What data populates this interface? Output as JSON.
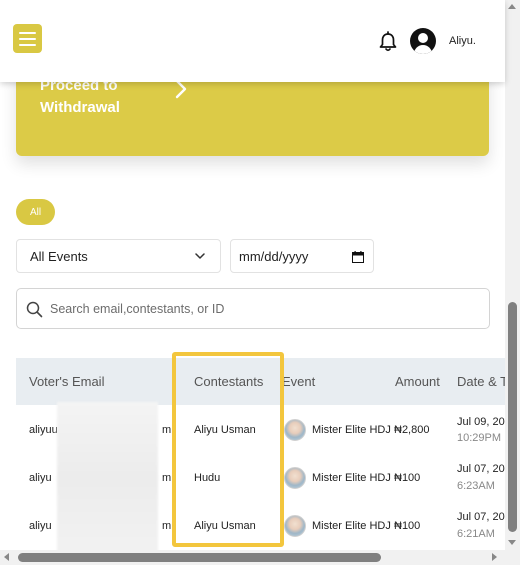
{
  "header": {
    "menu_icon": "hamburger-menu-icon",
    "notification_icon": "bell-icon",
    "avatar_icon": "user-avatar-icon",
    "username": "Aliyu."
  },
  "withdrawal_card": {
    "label_line1": "Proceed to",
    "label_line2": "Withdrawal",
    "chevron_icon": "chevron-right-icon"
  },
  "filters": {
    "chip_label": "All",
    "event_select": "All Events",
    "date_placeholder": "mm/dd/yyyy"
  },
  "search": {
    "placeholder": "Search email,contestants, or ID"
  },
  "table": {
    "headers": {
      "email": "Voter's Email",
      "contestants": "Contestants",
      "event": "Event",
      "amount": "Amount",
      "date": "Date & T"
    },
    "rows": [
      {
        "email_prefix": "aliyuu",
        "email_suffix": "m",
        "contestant": "Aliyu Usman",
        "event": "Mister Elite HDJ",
        "amount": "₦2,800",
        "date": "Jul 09, 20",
        "time": "10:29PM"
      },
      {
        "email_prefix": "aliyu",
        "email_suffix": "m",
        "contestant": "Hudu",
        "event": "Mister Elite HDJ",
        "amount": "₦100",
        "date": "Jul 07, 20",
        "time": "6:23AM"
      },
      {
        "email_prefix": "aliyu",
        "email_suffix": "m",
        "contestant": "Aliyu Usman",
        "event": "Mister Elite HDJ",
        "amount": "₦100",
        "date": "Jul 07, 20",
        "time": "6:21AM"
      }
    ]
  },
  "colors": {
    "accent": "#d9c843",
    "highlight": "#f3c63d",
    "table_header_bg": "#e8edf1"
  }
}
